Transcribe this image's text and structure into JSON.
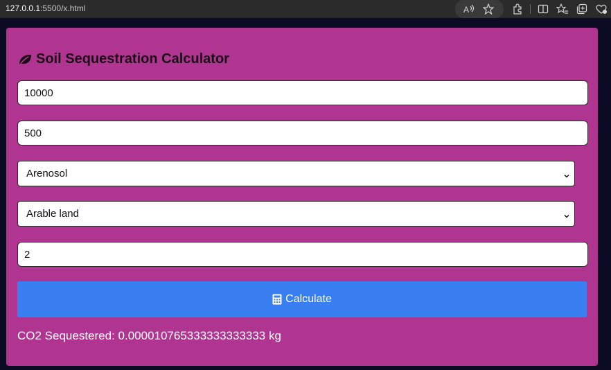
{
  "browser": {
    "url_host": "127.0.0.1",
    "url_rest": ":5500/x.html",
    "icons": [
      "read-aloud-icon",
      "favorite-star-icon",
      "extensions-icon",
      "split-screen-icon",
      "favorites-list-icon",
      "collections-icon",
      "browser-essentials-icon"
    ]
  },
  "app": {
    "title": "Soil Sequestration Calculator",
    "title_icon": "leaf-icon",
    "fields": {
      "input1_value": "10000",
      "input2_value": "500",
      "soil_type_selected": "Arenosol",
      "land_use_selected": "Arable land",
      "input3_value": "2"
    },
    "calculate_label": "Calculate",
    "calculate_icon": "calculator-icon",
    "result_text": "CO2 Sequestered: 0.000010765333333333333 kg"
  },
  "colors": {
    "card_bg": "#b03591",
    "button_bg": "#3a7ff2",
    "page_bg": "#0b0c23"
  }
}
